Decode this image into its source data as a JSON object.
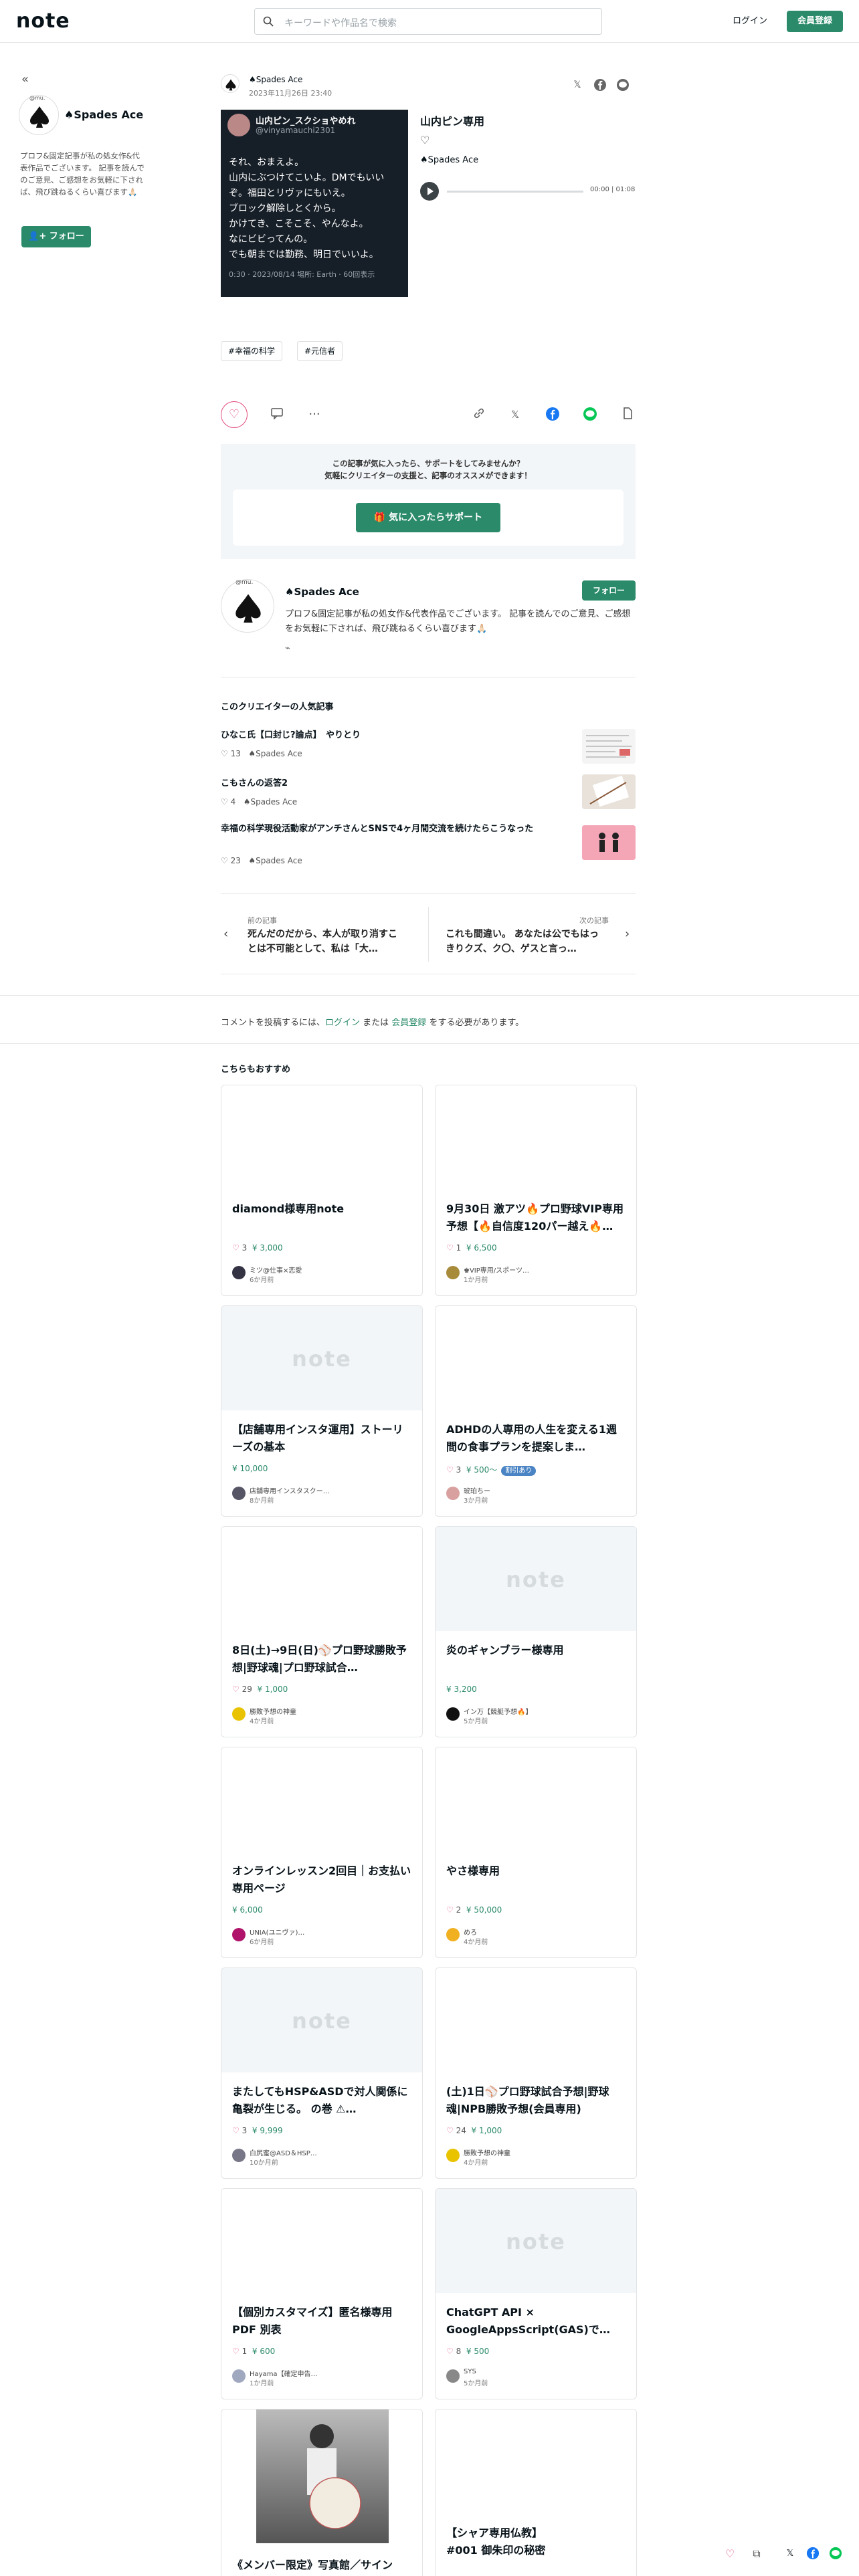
{
  "header": {
    "logo": "note",
    "search_placeholder": "キーワードや作品名で検索",
    "login": "ログイン",
    "register": "会員登録"
  },
  "sidebar": {
    "avatar_caption": "@mu.",
    "name": "♠Spades Ace",
    "bio": "プロフ&固定記事が私の処女作&代表作品でございます。 記事を読んでのご意見、ご感想をお気軽に下されば、飛び跳ねるくらい喜びます🙏🏻",
    "follow": "フォロー"
  },
  "article": {
    "author": "♠Spades Ace",
    "date": "2023年11月26日 23:40",
    "tweet": {
      "name": "山内ピン_スクショやめれ",
      "handle": "@vinyamauchi2301",
      "body": "それ、おまえよ。\n山内にぶつけてこいよ。DMでもいいぞ。福田とリヴァにもいえ。\nブロック解除しとくから。\nかけてき、こそこそ、やんなよ。\nなにビビってんの。\nでも朝までは勤務、明日でいいよ。",
      "footer": "0:30 · 2023/08/14 場所: Earth · 60回表示"
    },
    "audio": {
      "title": "山内ピン専用",
      "author": "♠Spades Ace",
      "time": "00:00 | 01:08"
    },
    "tags": [
      "#幸福の科学",
      "#元信者"
    ]
  },
  "support": {
    "line1": "この記事が気に入ったら、サポートをしてみませんか？",
    "line2": "気軽にクリエイターの支援と、記事のオススメができます！",
    "button": "気に入ったらサポート"
  },
  "profile": {
    "avatar_caption": "@mu.",
    "name": "♠Spades Ace",
    "follow": "フォロー",
    "bio": "プロフ&固定記事が私の処女作&代表作品でございます。 記事を読んでのご意見、ご感想をお気軽に下されば、飛び跳ねるくらい喜びます🙏🏻"
  },
  "popular": {
    "heading": "このクリエイターの人気記事",
    "items": [
      {
        "title": "ひなこ氏【口封じ?論点】　やりとり",
        "likes": "13",
        "author": "♠Spades Ace"
      },
      {
        "title": "こもさんの返答2",
        "likes": "4",
        "author": "♠Spades Ace"
      },
      {
        "title": "幸福の科学現役活動家がアンチさんとSNSで4ヶ月間交流を続けたらこうなった",
        "likes": "23",
        "author": "♠Spades Ace"
      }
    ]
  },
  "prevnext": {
    "prev_label": "前の記事",
    "prev_title": "死んだのだから、本人が取り消すことは不可能として、私は「大…",
    "next_label": "次の記事",
    "next_title": "これも間違い。 あなたは公でもはっきりクズ、ク〇、ゲスと言っ…"
  },
  "comment": {
    "pre": "コメントを投稿するには、",
    "login": "ログイン",
    "mid": " または ",
    "register": "会員登録",
    "post": " をする必要があります。"
  },
  "recommend": {
    "heading": "こちらもおすすめ",
    "placeholder_logo": "note",
    "cards": [
      {
        "title": "diamond様専用note",
        "likes": "3",
        "price": "¥ 3,000",
        "creator": "ミツ@仕事×恋愛",
        "ago": "6か月前",
        "placeholder": false,
        "badge": ""
      },
      {
        "title": "9月30日 激アツ🔥プロ野球VIP専用予想【🔥自信度120パー越え🔥…",
        "likes": "1",
        "price": "¥ 6,500",
        "creator": "♚VIP専用/スポーツ…",
        "ago": "1か月前",
        "placeholder": false,
        "badge": ""
      },
      {
        "title": "【店舗専用インスタ運用】ストーリーズの基本",
        "likes": "",
        "price": "¥ 10,000",
        "creator": "店舗専用インスタスクー…",
        "ago": "8か月前",
        "placeholder": true,
        "badge": ""
      },
      {
        "title": "ADHDの人専用の人生を変える1週間の食事プランを提案しま…",
        "likes": "3",
        "price": "¥ 500〜",
        "creator": "琥珀ちー",
        "ago": "3か月前",
        "placeholder": false,
        "badge": "割引あり"
      },
      {
        "title": "8日(土)→9日(日)⚾プロ野球勝敗予想|野球魂|プロ野球試合…",
        "likes": "29",
        "price": "¥ 1,000",
        "creator": "勝敗予想の神童",
        "ago": "4か月前",
        "placeholder": false,
        "badge": ""
      },
      {
        "title": "炎のギャンブラー様専用",
        "likes": "",
        "price": "¥ 3,200",
        "creator": "イン万【競艇予想🔥】",
        "ago": "5か月前",
        "placeholder": true,
        "badge": ""
      },
      {
        "title": "オンラインレッスン2回目｜お支払い専用ページ",
        "likes": "",
        "price": "¥ 6,000",
        "creator": "UNIA(ユニヴァ)…",
        "ago": "6か月前",
        "placeholder": false,
        "badge": ""
      },
      {
        "title": "やさ様専用",
        "likes": "2",
        "price": "¥ 50,000",
        "creator": "めろ",
        "ago": "4か月前",
        "placeholder": false,
        "badge": ""
      },
      {
        "title": "またしてもHSP&ASDで対人関係に亀裂が生じる。 の巻 ⚠…",
        "likes": "3",
        "price": "¥ 9,999",
        "creator": "白尻蜜@ASD＆HSP…",
        "ago": "10か月前",
        "placeholder": true,
        "badge": ""
      },
      {
        "title": "(土)1日⚾プロ野球試合予想|野球魂|NPB勝敗予想(会員専用)",
        "likes": "24",
        "price": "¥ 1,000",
        "creator": "勝敗予想の神童",
        "ago": "4か月前",
        "placeholder": false,
        "badge": ""
      },
      {
        "title": "【個別カスタマイズ】匿名様専用PDF 別表",
        "likes": "1",
        "price": "¥ 600",
        "creator": "Hayama【確定申告…",
        "ago": "1か月前",
        "placeholder": false,
        "badge": ""
      },
      {
        "title": "ChatGPT API × GoogleAppsScript(GAS)で…",
        "likes": "8",
        "price": "¥ 500",
        "creator": "SYS",
        "ago": "5か月前",
        "placeholder": true,
        "badge": ""
      },
      {
        "title": "《メンバー限定》写真館／サイン",
        "likes": "",
        "price": "",
        "creator": "",
        "ago": "",
        "placeholder": false,
        "badge": ""
      },
      {
        "title": "【シャア専用仏教】\n#001 御朱印の秘密",
        "likes": "",
        "price": "",
        "creator": "",
        "ago": "",
        "placeholder": false,
        "badge": ""
      }
    ]
  },
  "colors": {
    "accent": "#2a8a6a",
    "like": "#e24a7a",
    "badge": "#4a84c4"
  }
}
